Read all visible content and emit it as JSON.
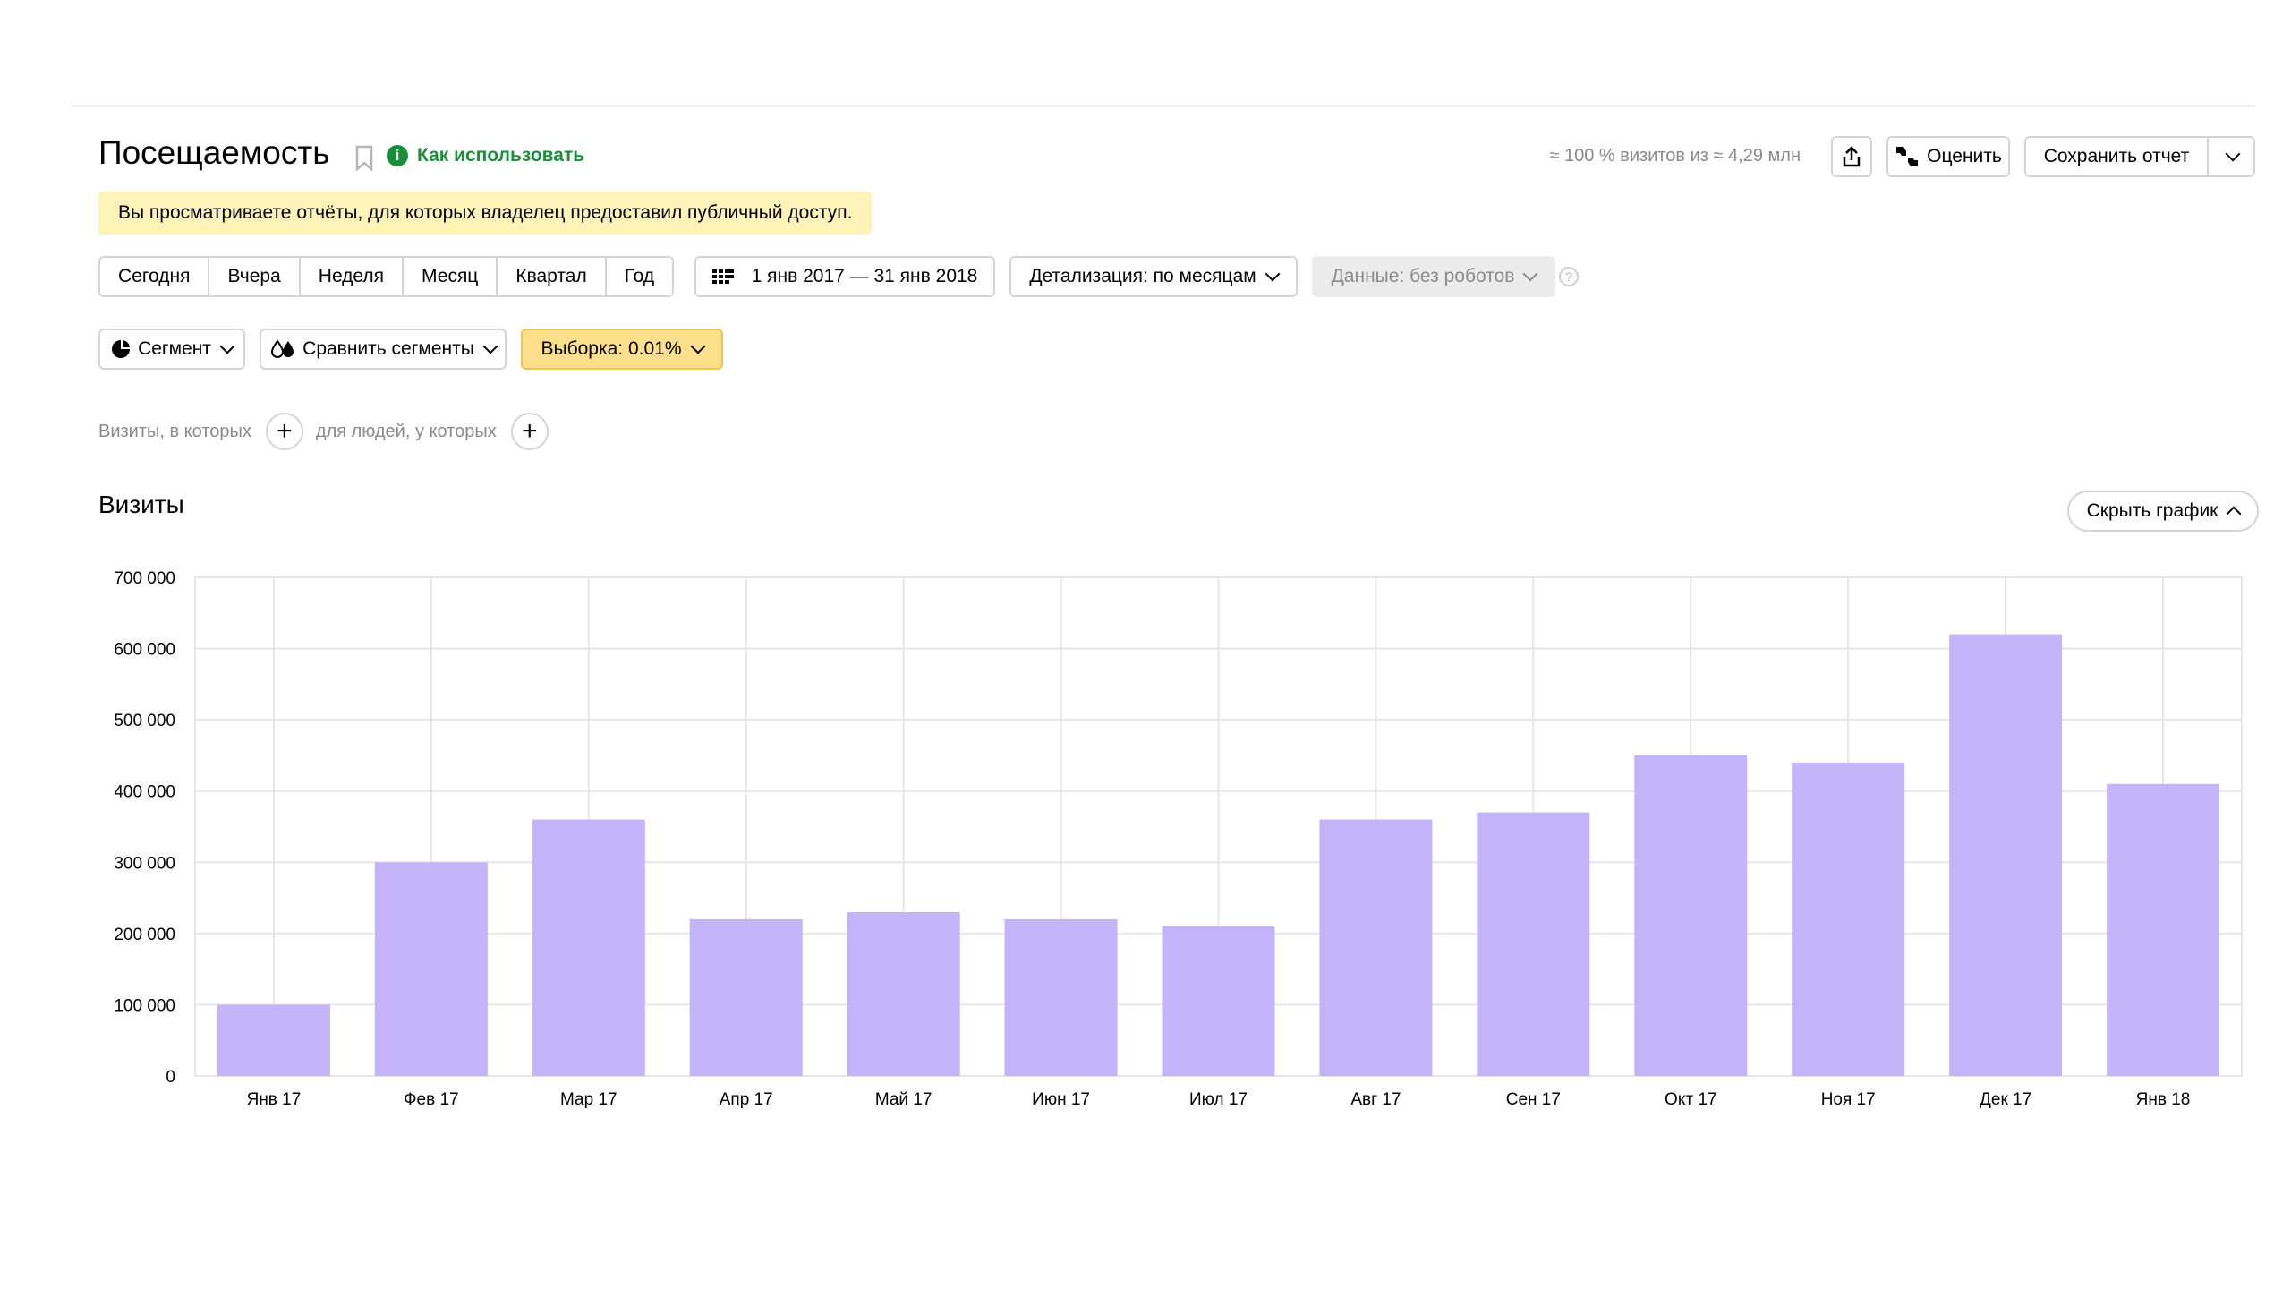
{
  "header": {
    "title": "Посещаемость",
    "how_to_use": "Как использовать",
    "sampling_info": "≈ 100 % визитов из ≈ 4,29 млн",
    "rate_label": "Оценить",
    "save_label": "Сохранить отчет"
  },
  "notice": "Вы просматриваете отчёты, для которых владелец предоставил публичный доступ.",
  "periods": [
    "Сегодня",
    "Вчера",
    "Неделя",
    "Месяц",
    "Квартал",
    "Год"
  ],
  "date_range": "1 янв 2017 — 31 янв 2018",
  "detail_label": "Детализация: по месяцам",
  "data_label": "Данные: без роботов",
  "segment_label": "Сегмент",
  "compare_label": "Сравнить сегменты",
  "sample_label": "Выборка: 0.01%",
  "filters": {
    "visits_label": "Визиты, в которых",
    "people_label": "для людей, у которых"
  },
  "visits_section": {
    "title": "Визиты",
    "hide_chart_label": "Скрыть график"
  },
  "colors": {
    "bar": "#c3b3f8",
    "notice": "#fdf2b8",
    "accent_green": "#1a8f3a",
    "sample_button": "#fcdf8a"
  },
  "chart_data": {
    "type": "bar",
    "categories": [
      "Янв 17",
      "Фев 17",
      "Мар 17",
      "Апр 17",
      "Май 17",
      "Июн 17",
      "Июл 17",
      "Авг 17",
      "Сен 17",
      "Окт 17",
      "Ноя 17",
      "Дек 17",
      "Янв 18"
    ],
    "values": [
      100000,
      300000,
      360000,
      220000,
      230000,
      220000,
      210000,
      360000,
      370000,
      450000,
      440000,
      620000,
      410000
    ],
    "ylim": [
      0,
      700000
    ],
    "yticks": [
      0,
      100000,
      200000,
      300000,
      400000,
      500000,
      600000,
      700000
    ],
    "ytick_labels": [
      "0",
      "100 000",
      "200 000",
      "300 000",
      "400 000",
      "500 000",
      "600 000",
      "700 000"
    ],
    "grid": true
  }
}
